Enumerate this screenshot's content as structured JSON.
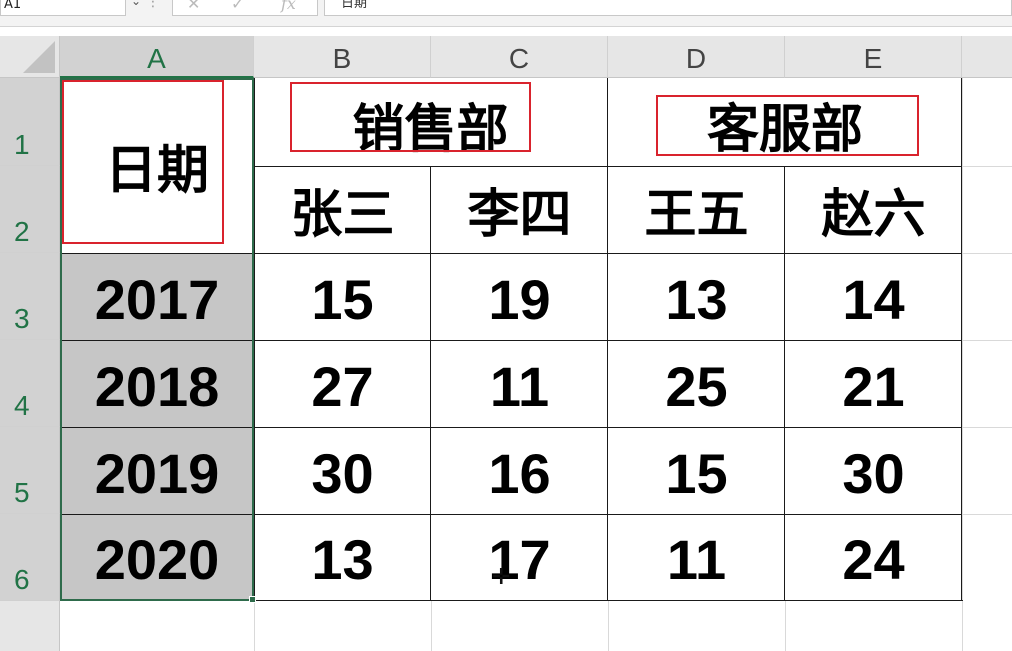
{
  "formula_bar": {
    "name_box": "A1",
    "formula": "日期"
  },
  "columns": [
    "A",
    "B",
    "C",
    "D",
    "E"
  ],
  "rows": [
    "1",
    "2",
    "3",
    "4",
    "5",
    "6"
  ],
  "table": {
    "date_header": "日期",
    "departments": [
      "销售部",
      "客服部"
    ],
    "people": [
      "张三",
      "李四",
      "王五",
      "赵六"
    ],
    "data_rows": [
      {
        "year": "2017",
        "values": [
          "15",
          "19",
          "13",
          "14"
        ]
      },
      {
        "year": "2018",
        "values": [
          "27",
          "11",
          "25",
          "21"
        ]
      },
      {
        "year": "2019",
        "values": [
          "30",
          "16",
          "15",
          "30"
        ]
      },
      {
        "year": "2020",
        "values": [
          "13",
          "17",
          "11",
          "24"
        ]
      }
    ]
  },
  "icons": {
    "cancel": "close-icon",
    "confirm": "check-icon",
    "function": "function-icon",
    "cursor": "crosshair-cursor-icon"
  },
  "colors": {
    "selection": "#2e6b4b",
    "highlight_box": "#d9232d",
    "year_fill": "#c6c6c6"
  }
}
